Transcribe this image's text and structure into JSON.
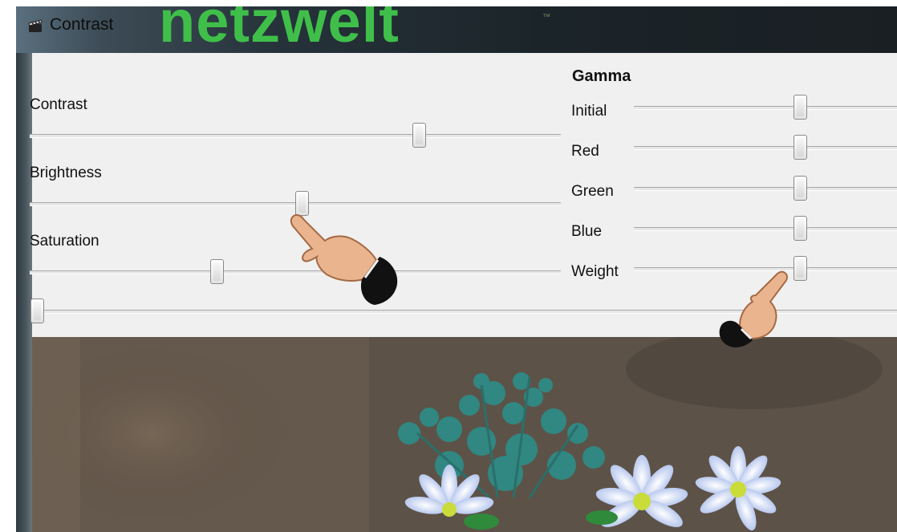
{
  "window": {
    "title": "Contrast",
    "watermark": "netzwelt",
    "watermark_tm": "™"
  },
  "left_sliders": [
    {
      "label": "Contrast",
      "value": 0.72
    },
    {
      "label": "Brightness",
      "value": 0.5
    },
    {
      "label": "Saturation",
      "value": 0.34
    }
  ],
  "bottom_slider": {
    "value": 0.0
  },
  "gamma": {
    "title": "Gamma",
    "sliders": [
      {
        "label": "Initial",
        "value": 0.53
      },
      {
        "label": "Red",
        "value": 0.53
      },
      {
        "label": "Green",
        "value": 0.53
      },
      {
        "label": "Blue",
        "value": 0.53
      },
      {
        "label": "Weight",
        "value": 0.53
      }
    ]
  },
  "colors": {
    "watermark_green": "#3fbf4a",
    "window_bg": "#f0f0f0"
  }
}
